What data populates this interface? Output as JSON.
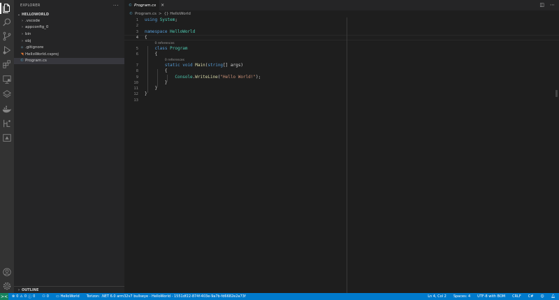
{
  "activity_bar": {
    "icons": [
      "files-icon",
      "search-icon",
      "source-control-icon",
      "run-debug-icon",
      "extensions-icon",
      "remote-explorer-icon",
      "testing-icon",
      "docker-icon",
      "torizon-icon",
      "remote-device-icon"
    ],
    "bottom_icons": [
      "accounts-icon",
      "settings-gear-icon"
    ]
  },
  "sidebar": {
    "title": "EXPLORER",
    "more": "···",
    "workspace": "HELLOWORLD",
    "items": [
      {
        "label": ".vscode",
        "kind": "folder"
      },
      {
        "label": "appconfig_0",
        "kind": "folder"
      },
      {
        "label": "bin",
        "kind": "folder"
      },
      {
        "label": "obj",
        "kind": "folder"
      },
      {
        "label": ".gitignore",
        "kind": "file"
      },
      {
        "label": "HelloWorld.csproj",
        "kind": "file"
      },
      {
        "label": "Program.cs",
        "kind": "file"
      }
    ],
    "outline": "OUTLINE"
  },
  "tabs": [
    {
      "label": "Program.cs",
      "lang": "C#"
    }
  ],
  "breadcrumb": {
    "file": "Program.cs",
    "sep": ">",
    "symbol": "{} HelloWorld"
  },
  "editor": {
    "lines": [
      {
        "n": "1",
        "tokens": [
          [
            "kw",
            "using"
          ],
          [
            "pl",
            " "
          ],
          [
            "ty",
            "System"
          ],
          [
            "pl",
            ";"
          ]
        ]
      },
      {
        "n": "2",
        "tokens": []
      },
      {
        "n": "3",
        "tokens": [
          [
            "kw",
            "namespace"
          ],
          [
            "pl",
            " "
          ],
          [
            "ty",
            "HelloWorld"
          ]
        ]
      },
      {
        "n": "4",
        "tokens": [
          [
            "pl",
            "{"
          ]
        ]
      },
      {
        "lens": "0 references",
        "indent": "    "
      },
      {
        "n": "5",
        "tokens": [
          [
            "pl",
            "    "
          ],
          [
            "kw",
            "class"
          ],
          [
            "pl",
            " "
          ],
          [
            "ty",
            "Program"
          ]
        ]
      },
      {
        "n": "6",
        "tokens": [
          [
            "pl",
            "    {"
          ]
        ]
      },
      {
        "lens": "0 references",
        "indent": "        "
      },
      {
        "n": "7",
        "tokens": [
          [
            "pl",
            "        "
          ],
          [
            "kw",
            "static"
          ],
          [
            "pl",
            " "
          ],
          [
            "kw",
            "void"
          ],
          [
            "pl",
            " "
          ],
          [
            "fn",
            "Main"
          ],
          [
            "pl",
            "("
          ],
          [
            "kw",
            "string"
          ],
          [
            "pl",
            "[] "
          ],
          [
            "pl",
            "args"
          ],
          [
            "pl",
            ")"
          ]
        ]
      },
      {
        "n": "8",
        "tokens": [
          [
            "pl",
            "        {"
          ]
        ]
      },
      {
        "n": "9",
        "tokens": [
          [
            "pl",
            "            "
          ],
          [
            "ty",
            "Console"
          ],
          [
            "pl",
            "."
          ],
          [
            "fn",
            "WriteLine"
          ],
          [
            "pl",
            "("
          ],
          [
            "str",
            "\"Hello World!\""
          ],
          [
            "pl",
            ");"
          ]
        ]
      },
      {
        "n": "10",
        "tokens": [
          [
            "pl",
            "        }"
          ]
        ]
      },
      {
        "n": "11",
        "tokens": [
          [
            "pl",
            "    }"
          ]
        ]
      },
      {
        "n": "12",
        "tokens": [
          [
            "pl",
            "}"
          ]
        ]
      },
      {
        "n": "13",
        "tokens": []
      }
    ],
    "active_line": "4"
  },
  "status_bar": {
    "remote": "><",
    "problems_errors": "0",
    "problems_warnings": "0",
    "warnings2": "0",
    "ports": "0",
    "folder": "HelloWorld",
    "torizon": "Torizon: .NET 6.0 arm32v7 bullseye - HelloWorld - 1551df22-874f-403e-9a7b-fd6682e2a73f",
    "position": "Ln 4, Col 2",
    "spaces": "Spaces: 4",
    "encoding": "UTF-8 with BOM",
    "eol": "CRLF",
    "language": "C#"
  }
}
